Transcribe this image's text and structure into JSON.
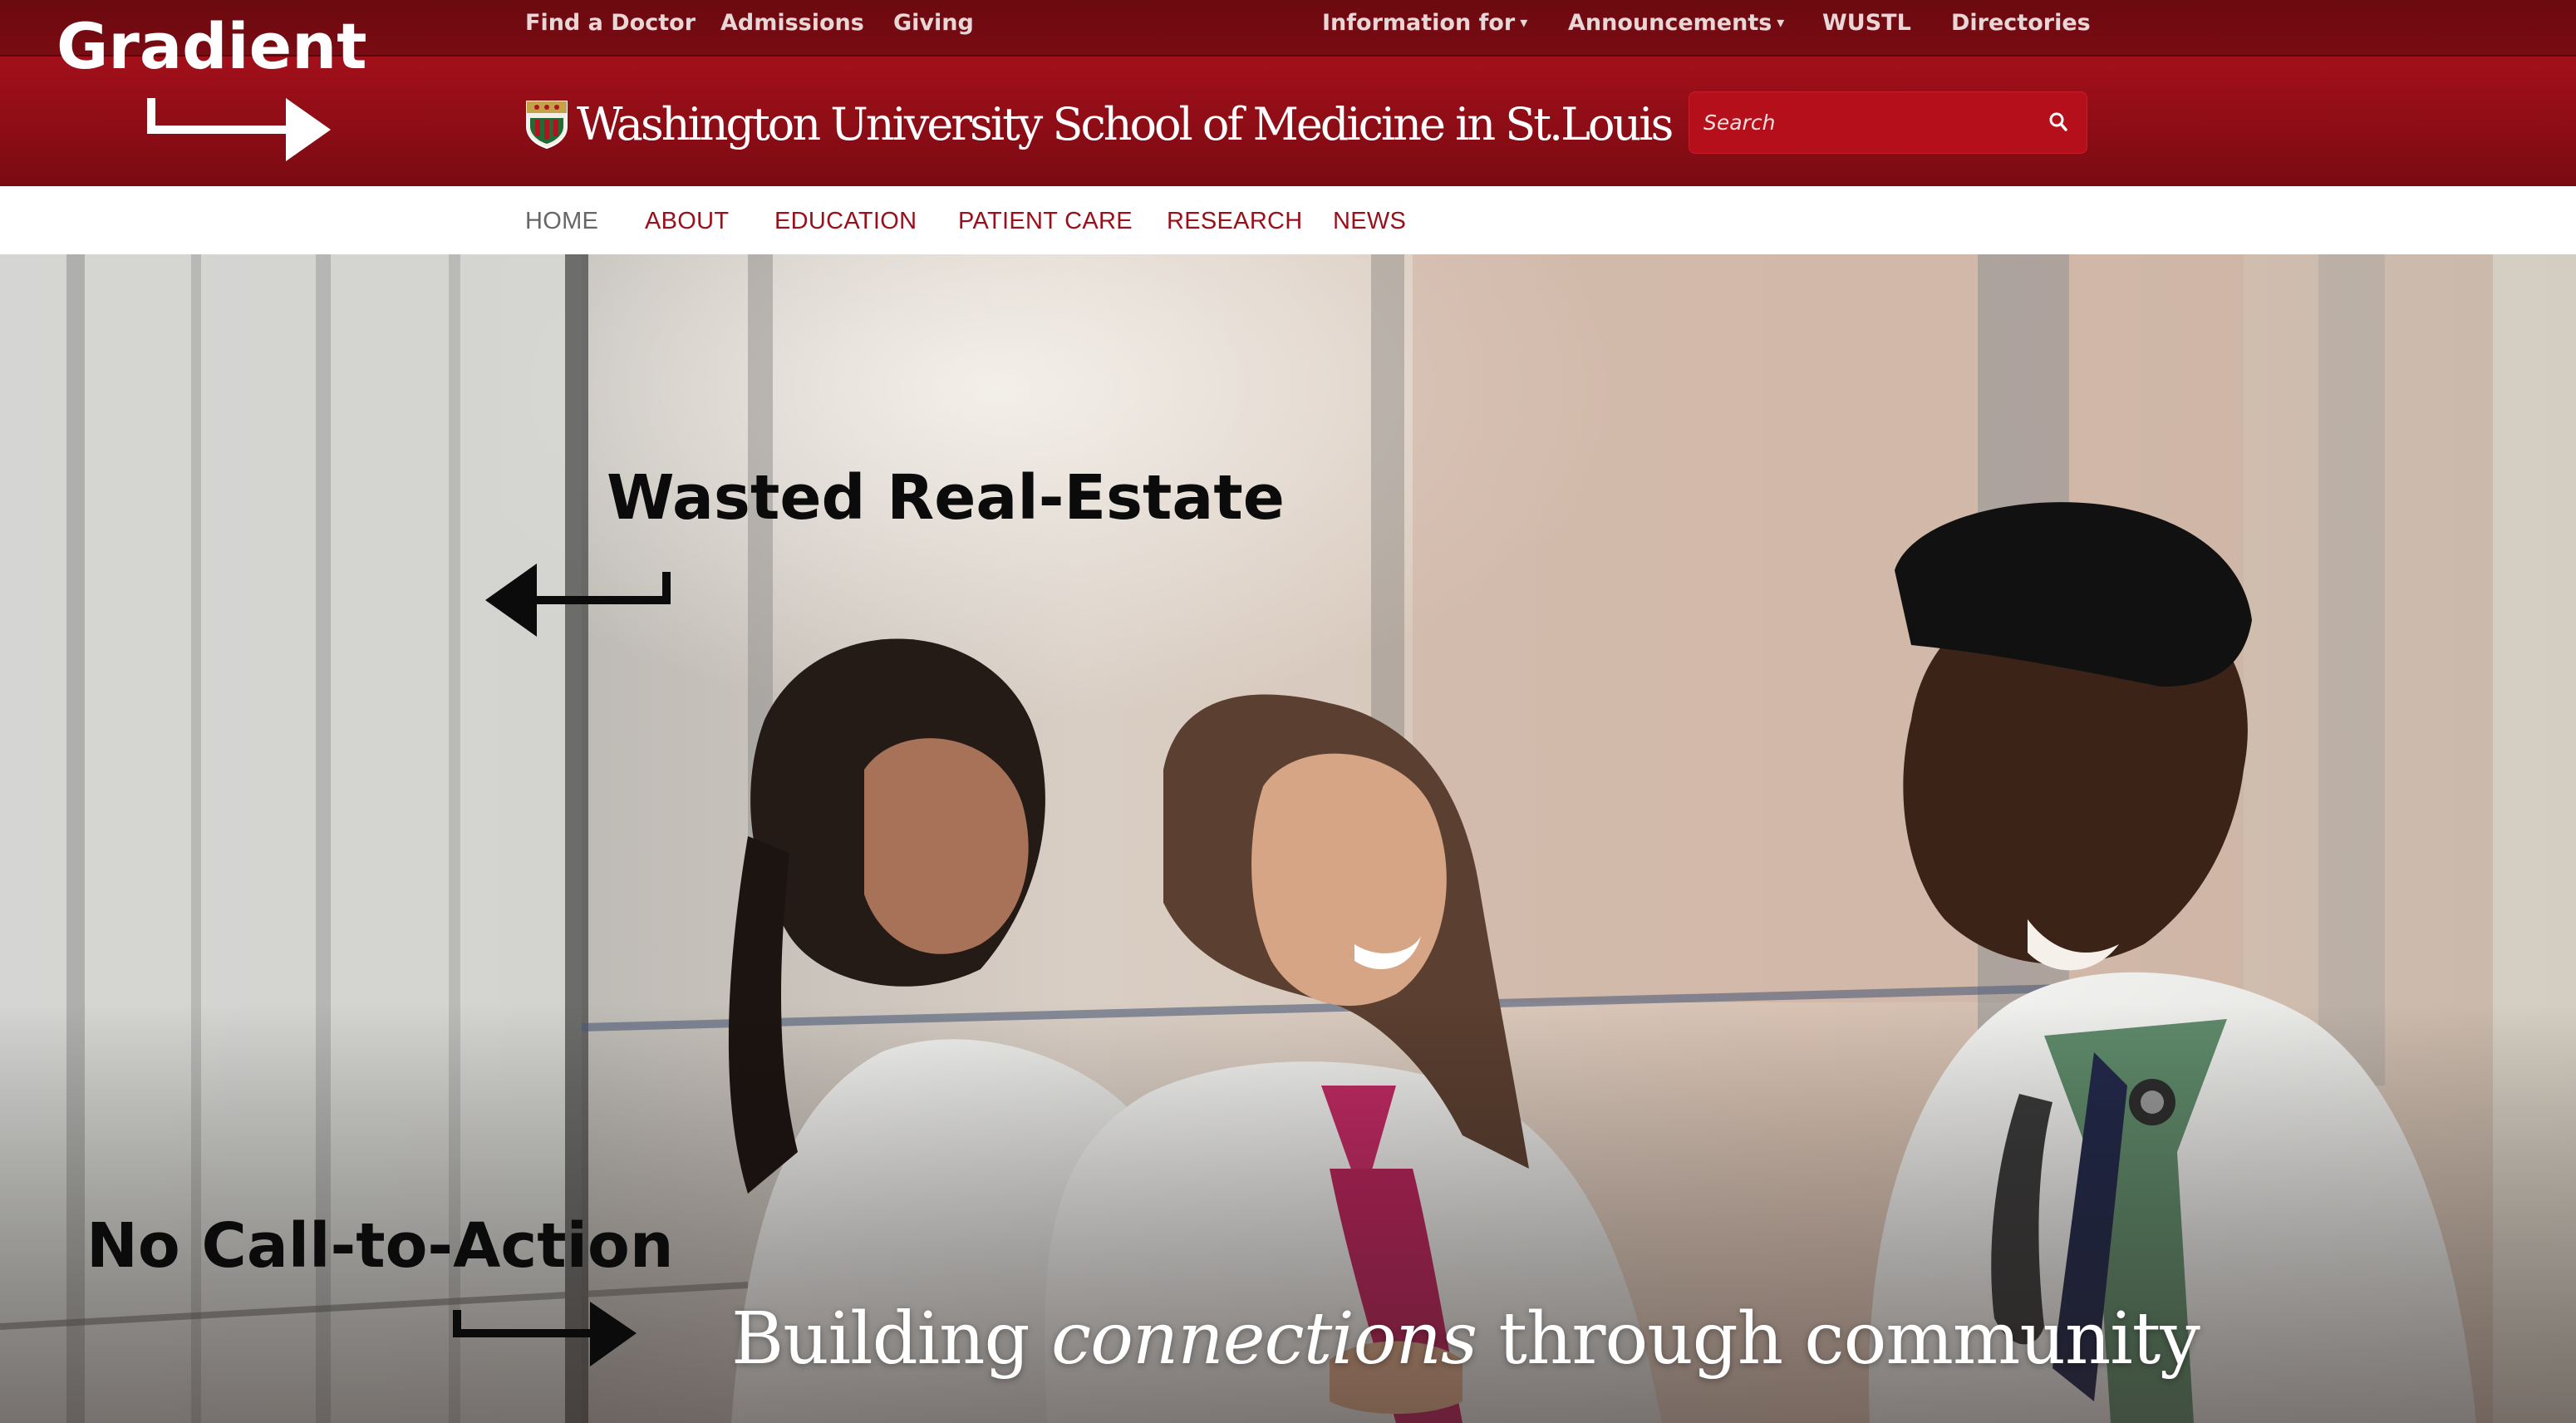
{
  "header": {
    "utility_links": [
      {
        "label": "Find a Doctor"
      },
      {
        "label": "Admissions"
      },
      {
        "label": "Giving"
      },
      {
        "label": "Information for",
        "caret": "▾"
      },
      {
        "label": "Announcements",
        "caret": "▾"
      },
      {
        "label": "WUSTL"
      },
      {
        "label": "Directories"
      }
    ],
    "brand_name": "Washington University School of Medicine in St.Louis",
    "search": {
      "placeholder": "Search",
      "icon": "search-icon"
    }
  },
  "nav": {
    "items": [
      {
        "label": "HOME",
        "active": true
      },
      {
        "label": "ABOUT"
      },
      {
        "label": "EDUCATION"
      },
      {
        "label": "PATIENT CARE"
      },
      {
        "label": "RESEARCH"
      },
      {
        "label": "NEWS"
      }
    ]
  },
  "hero": {
    "headline_part1": "Building ",
    "headline_emphasis": "connections",
    "headline_part2": " through community"
  },
  "annotations": {
    "gradient": "Gradient",
    "wasted": "Wasted Real-Estate",
    "no_cta": "No Call-to-Action"
  },
  "colors": {
    "brand_red": "#a3101a",
    "header_dark": "#6b0a10",
    "nav_text": "#9b0f1b",
    "nav_active": "#666666"
  }
}
